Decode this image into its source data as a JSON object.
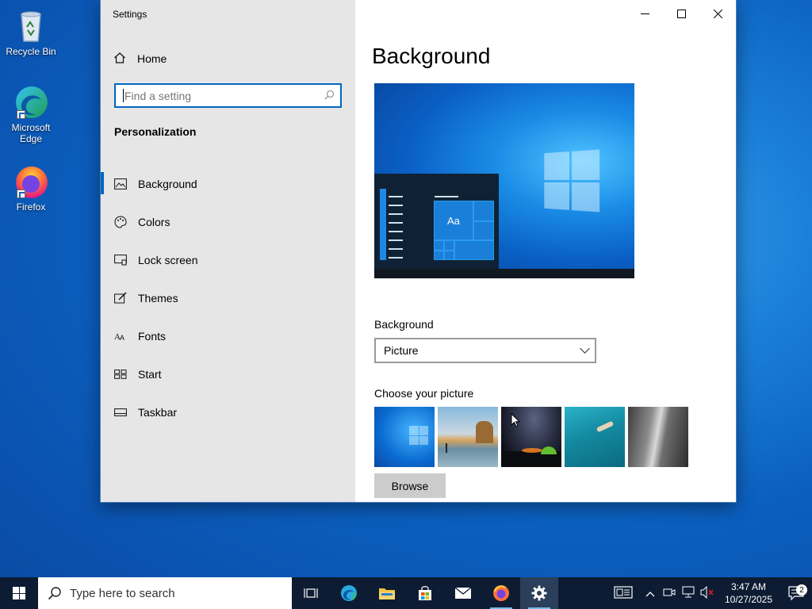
{
  "desktop": {
    "icons": [
      {
        "label": "Recycle Bin",
        "icon": "recycle-bin-icon"
      },
      {
        "label": "Microsoft Edge",
        "icon": "edge-icon"
      },
      {
        "label": "Firefox",
        "icon": "firefox-icon"
      }
    ]
  },
  "window": {
    "title": "Settings",
    "minimize_glyph": "─",
    "maximize_glyph": "☐",
    "close_glyph": "✕"
  },
  "sidebar": {
    "home_label": "Home",
    "search_placeholder": "Find a setting",
    "section": "Personalization",
    "items": [
      {
        "label": "Background",
        "icon": "picture-icon",
        "glyph": "🖼"
      },
      {
        "label": "Colors",
        "icon": "palette-icon",
        "glyph": "🎨"
      },
      {
        "label": "Lock screen",
        "icon": "lock-screen-icon",
        "glyph": "▭"
      },
      {
        "label": "Themes",
        "icon": "brush-icon",
        "glyph": "✎"
      },
      {
        "label": "Fonts",
        "icon": "font-icon",
        "glyph": "A"
      },
      {
        "label": "Start",
        "icon": "start-icon",
        "glyph": "⊞"
      },
      {
        "label": "Taskbar",
        "icon": "taskbar-icon",
        "glyph": "▭"
      }
    ],
    "active_index": 0
  },
  "main": {
    "title": "Background",
    "preview_tile_text": "Aa",
    "background_label": "Background",
    "background_value": "Picture",
    "choose_label": "Choose your picture",
    "browse_label": "Browse"
  },
  "taskbar": {
    "search_placeholder": "Type here to search",
    "apps": [
      "task-view-icon",
      "edge-icon",
      "file-explorer-icon",
      "store-icon",
      "mail-icon",
      "firefox-icon",
      "settings-gear-icon"
    ],
    "time": "3:47 AM",
    "date": "10/27/2025",
    "notification_count": "2"
  },
  "colors": {
    "accent": "#0067c0",
    "sidebar_bg": "#e6e6e6",
    "taskbar_bg": "#0d1c33"
  }
}
